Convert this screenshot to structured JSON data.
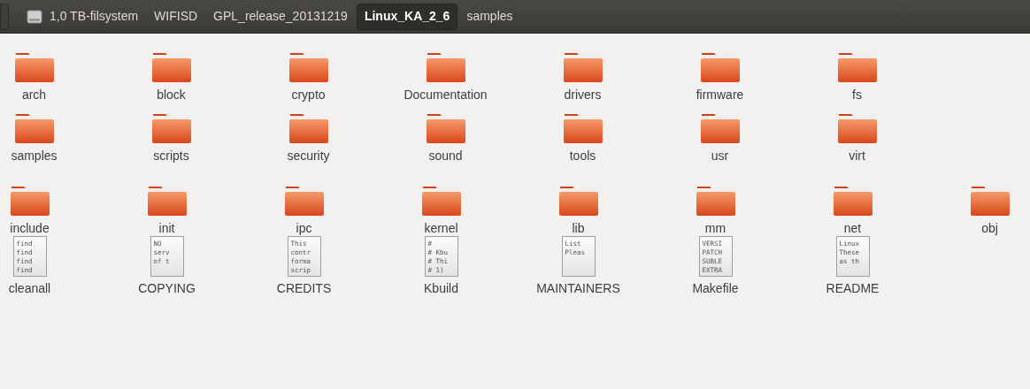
{
  "path_bar": [
    {
      "label": "1,0 TB-filsystem",
      "kind": "drive",
      "selected": false
    },
    {
      "label": "WIFISD",
      "kind": "folder",
      "selected": false
    },
    {
      "label": "GPL_release_20131219",
      "kind": "folder",
      "selected": false
    },
    {
      "label": "Linux_KA_2_6",
      "kind": "folder",
      "selected": true
    },
    {
      "label": "samples",
      "kind": "folder",
      "selected": false
    }
  ],
  "rows": [
    [
      {
        "name": "arch",
        "kind": "folder"
      },
      {
        "name": "block",
        "kind": "folder"
      },
      {
        "name": "crypto",
        "kind": "folder"
      },
      {
        "name": "Documentation",
        "kind": "folder"
      },
      {
        "name": "drivers",
        "kind": "folder"
      },
      {
        "name": "firmware",
        "kind": "folder"
      },
      {
        "name": "fs",
        "kind": "folder"
      }
    ],
    [
      {
        "name": "samples",
        "kind": "folder"
      },
      {
        "name": "scripts",
        "kind": "folder"
      },
      {
        "name": "security",
        "kind": "folder"
      },
      {
        "name": "sound",
        "kind": "folder"
      },
      {
        "name": "tools",
        "kind": "folder"
      },
      {
        "name": "usr",
        "kind": "folder"
      },
      {
        "name": "virt",
        "kind": "folder"
      }
    ],
    [
      {
        "name": "include",
        "kind": "folder"
      },
      {
        "name": "init",
        "kind": "folder"
      },
      {
        "name": "ipc",
        "kind": "folder"
      },
      {
        "name": "kernel",
        "kind": "folder"
      },
      {
        "name": "lib",
        "kind": "folder"
      },
      {
        "name": "mm",
        "kind": "folder"
      },
      {
        "name": "net",
        "kind": "folder"
      },
      {
        "name": "obj",
        "kind": "folder"
      }
    ],
    [
      {
        "name": "cleanall",
        "kind": "text",
        "preview": [
          "find",
          "find",
          "find",
          "find"
        ]
      },
      {
        "name": "COPYING",
        "kind": "text",
        "preview": [
          "NO",
          "serv",
          "of t"
        ]
      },
      {
        "name": "CREDITS",
        "kind": "text",
        "preview": [
          "This",
          "contr",
          "forma",
          "scrip"
        ]
      },
      {
        "name": "Kbuild",
        "kind": "text",
        "preview": [
          "#",
          "# Kbu",
          "# Thi",
          "# 1)"
        ]
      },
      {
        "name": "MAINTAINERS",
        "kind": "text",
        "preview": [
          "List",
          "Pleas"
        ]
      },
      {
        "name": "Makefile",
        "kind": "text",
        "preview": [
          "VERSI",
          "PATCH",
          "SUBLE",
          "EXTRA"
        ]
      },
      {
        "name": "README",
        "kind": "text",
        "preview": [
          "Linux",
          "These",
          "as th"
        ]
      }
    ]
  ]
}
